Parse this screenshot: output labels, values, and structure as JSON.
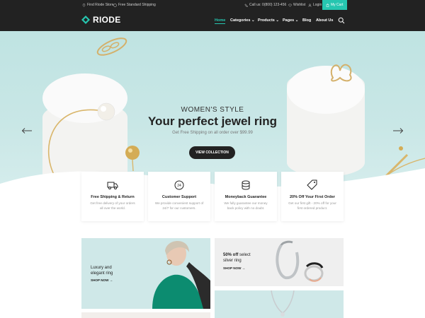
{
  "topbar": {
    "store": "Find Riode Store",
    "shipping": "Free Standard Shipping",
    "call": "Call us: 0(800) 123-456",
    "wishlist": "Wishlist",
    "login": "Login",
    "cart": "My Cart"
  },
  "brand": {
    "name": "RIODE",
    "accent": "#26c6b0"
  },
  "nav": {
    "home": "Home",
    "categories": "Categories",
    "products": "Products",
    "pages": "Pages",
    "blog": "Blog",
    "about": "About Us"
  },
  "hero": {
    "subtitle": "WOMEN'S STYLE",
    "title": "Your perfect jewel ring",
    "description": "Get Free Shipping on all order over $99.99",
    "button": "VIEW COLLECTION"
  },
  "features": [
    {
      "title": "Free Shipping & Return",
      "line1": "Get free delivery of your orders",
      "line2": "all over the world.",
      "icon": "truck-icon"
    },
    {
      "title": "Customer Support",
      "line1": "We provide convenient support of",
      "line2": "24/7 for our customers.",
      "icon": "support-24-icon"
    },
    {
      "title": "Moneyback Guarantee",
      "line1": "We fully guarantee our money",
      "line2": "back policy with no doubt.",
      "icon": "coins-icon"
    },
    {
      "title": "20% Off Your First Order",
      "line1": "Get our first gift - 20% off for your",
      "line2": "first ordered product.",
      "icon": "price-tag-icon"
    }
  ],
  "promos": {
    "p1_line1": "Luxury and",
    "p1_line2": "elegant ring",
    "p1_link": "SHOP NOW",
    "p2_bold": "50% off",
    "p2_rest": " select",
    "p2_line2": "silver ring",
    "p2_link": "SHOP NOW"
  }
}
